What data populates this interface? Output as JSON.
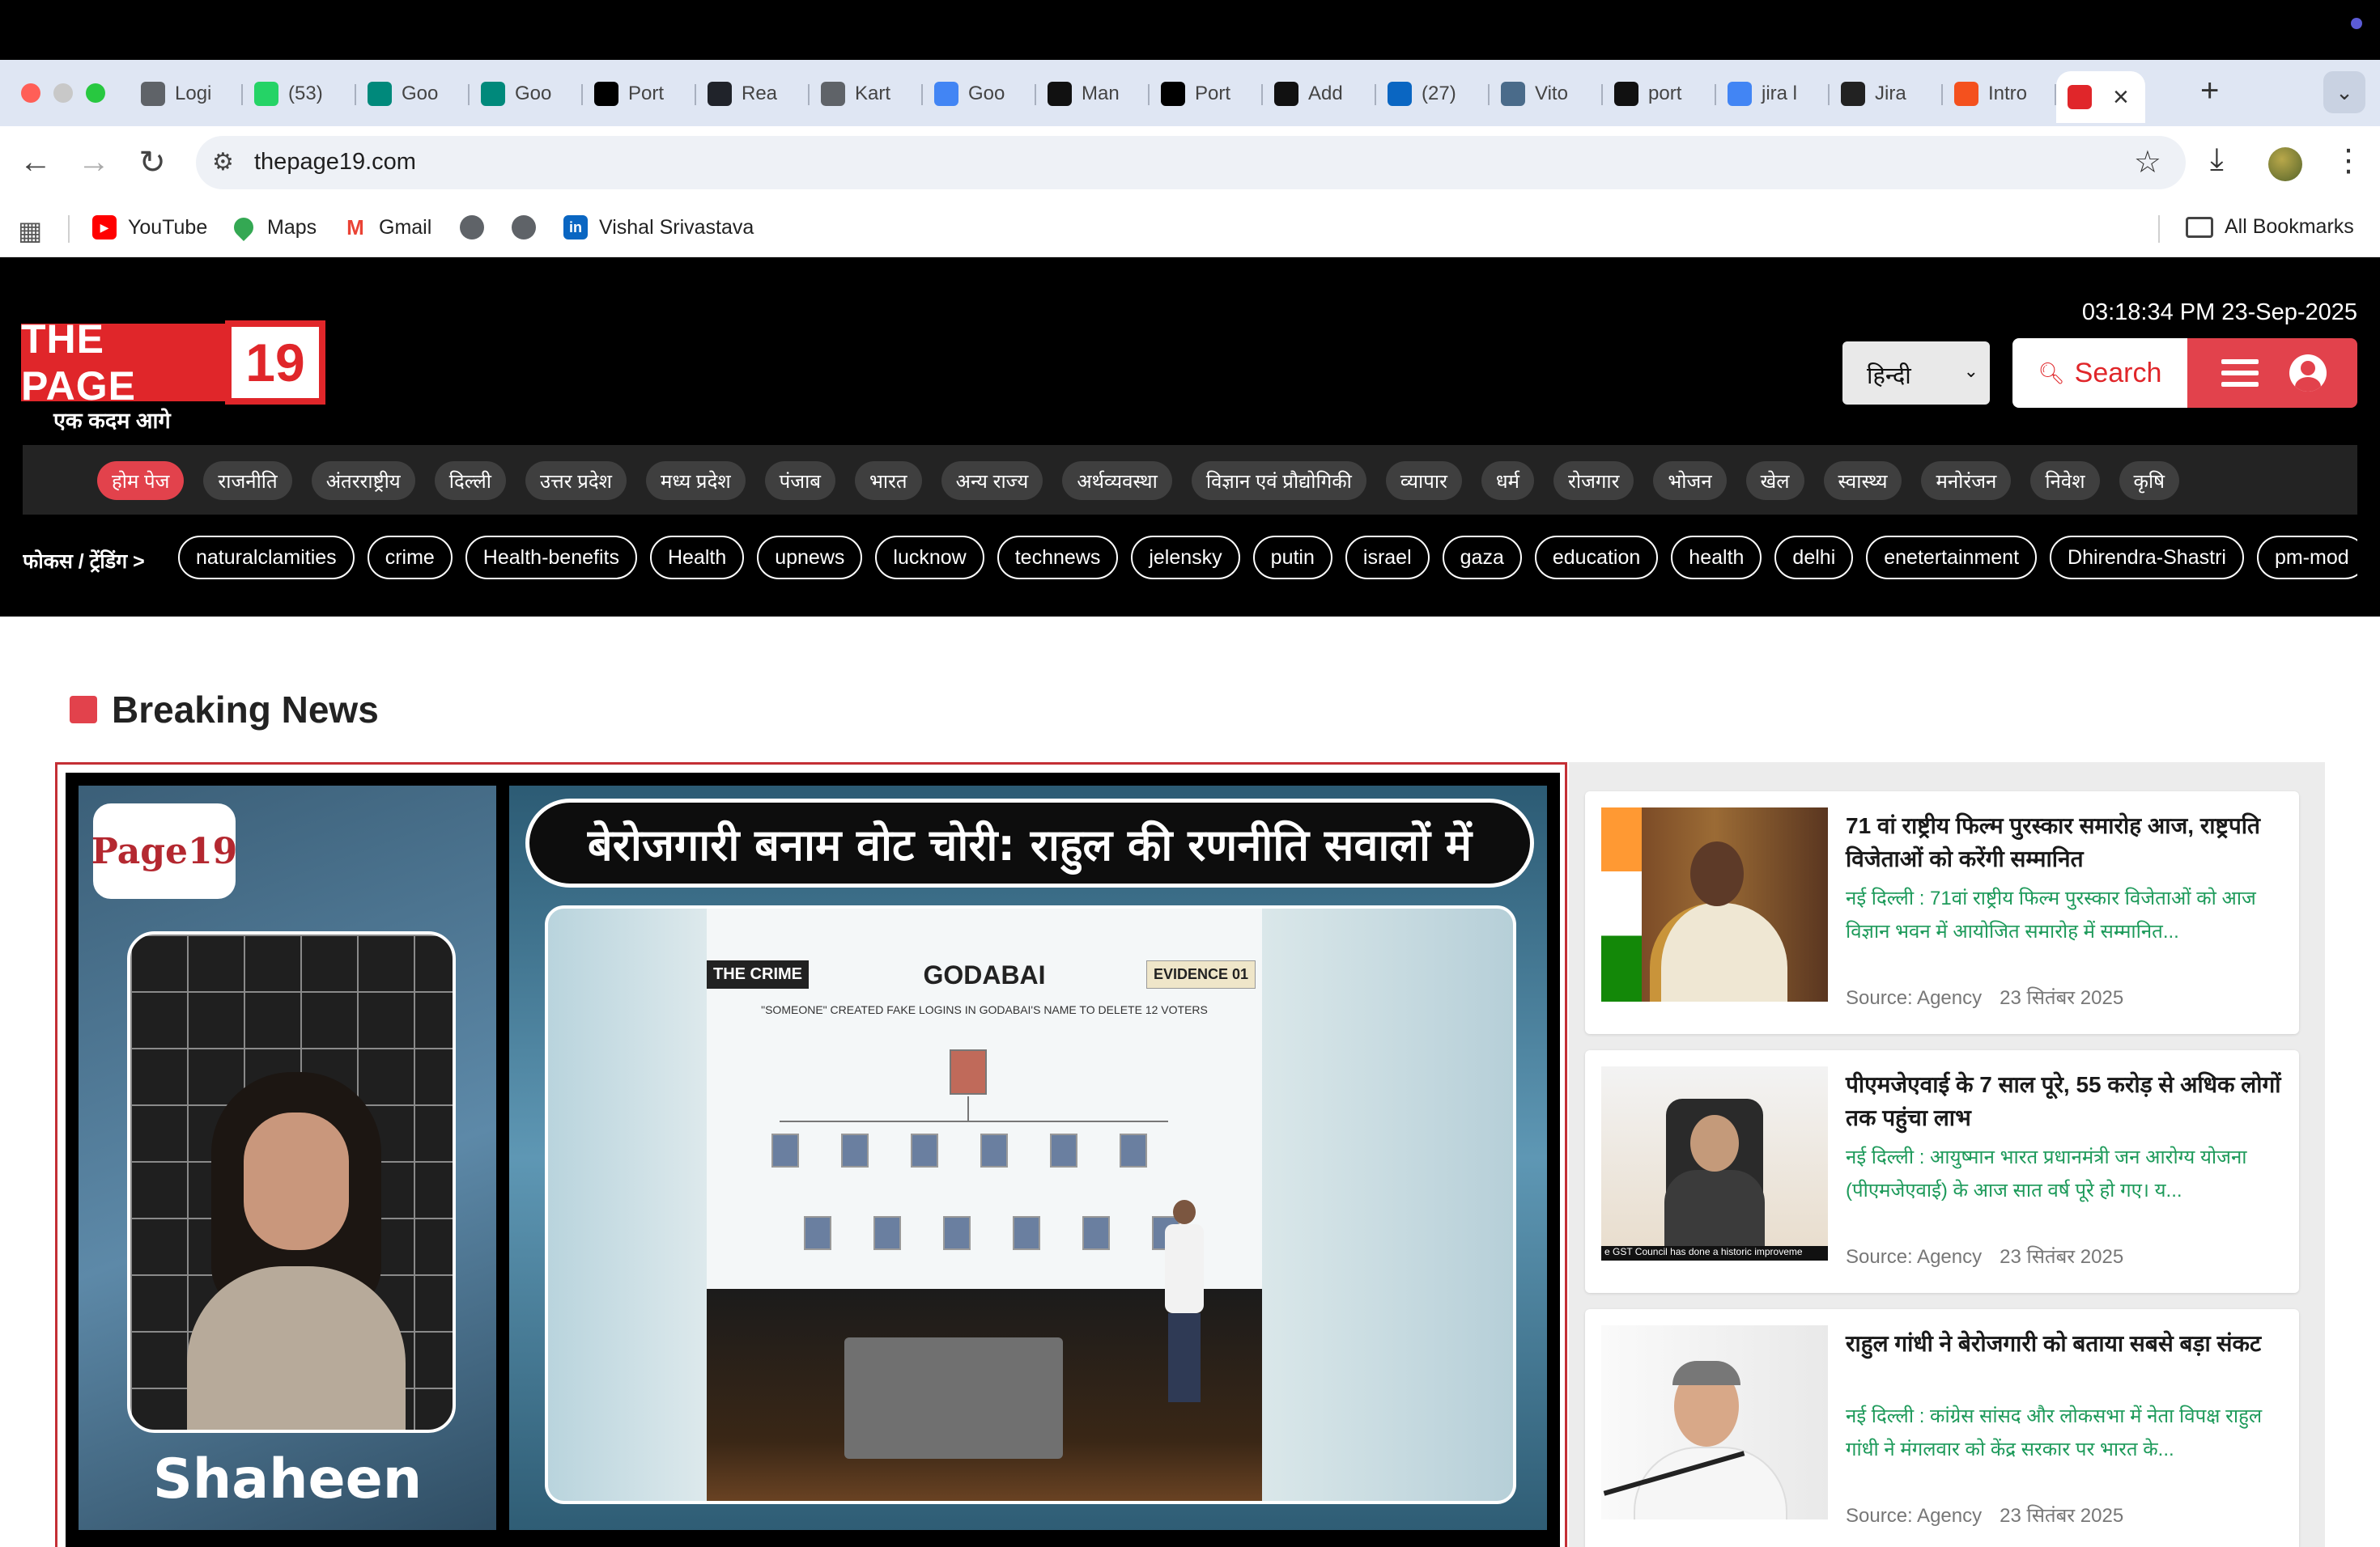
{
  "browser": {
    "tabs": [
      {
        "label": "Logi",
        "icon": "globe-icon",
        "color": "#5f6368"
      },
      {
        "label": "(53)",
        "icon": "whatsapp-icon",
        "color": "#25d366"
      },
      {
        "label": "Goo",
        "icon": "google-meet-icon",
        "color": "#00897b"
      },
      {
        "label": "Goo",
        "icon": "google-meet-icon",
        "color": "#00897b"
      },
      {
        "label": "Port",
        "icon": "vercel-icon",
        "color": "#000000"
      },
      {
        "label": "Rea",
        "icon": "react-icon",
        "color": "#20232a"
      },
      {
        "label": "Kart",
        "icon": "globe-icon",
        "color": "#5f6368"
      },
      {
        "label": "Goo",
        "icon": "gemini-icon",
        "color": "#4285f4"
      },
      {
        "label": "Man",
        "icon": "openai-icon",
        "color": "#111111"
      },
      {
        "label": "Port",
        "icon": "vercel-icon",
        "color": "#000000"
      },
      {
        "label": "Add",
        "icon": "openai-icon",
        "color": "#111111"
      },
      {
        "label": "(27)",
        "icon": "linkedin-icon",
        "color": "#0a66c2"
      },
      {
        "label": "Vito",
        "icon": "vitoria-icon",
        "color": "#4a6b8a"
      },
      {
        "label": "port",
        "icon": "github-icon",
        "color": "#111111"
      },
      {
        "label": "jira l",
        "icon": "google-icon",
        "color": "#4285f4"
      },
      {
        "label": "Jira",
        "icon": "hd-icon",
        "color": "#222222"
      },
      {
        "label": "Intro",
        "icon": "atlassian-icon",
        "color": "#f4511e"
      }
    ],
    "active_tab_icon": "thepage19-icon",
    "url": "thepage19.com",
    "bookmarks": [
      {
        "label": "YouTube",
        "icon": "youtube-icon"
      },
      {
        "label": "Maps",
        "icon": "maps-icon"
      },
      {
        "label": "Gmail",
        "icon": "gmail-icon"
      },
      {
        "label": "",
        "icon": "globe-icon"
      },
      {
        "label": "",
        "icon": "globe-icon"
      },
      {
        "label": "Vishal Srivastava",
        "icon": "linkedin-icon"
      }
    ],
    "all_bookmarks": "All Bookmarks"
  },
  "site": {
    "logo_text": "THE PAGE",
    "logo_number": "19",
    "tagline": "एक कदम आगे",
    "datetime": "03:18:34 PM 23-Sep-2025",
    "language": "हिन्दी",
    "search_label": "Search",
    "accent": "#e2424c",
    "categories": [
      "होम पेज",
      "राजनीति",
      "अंतरराष्ट्रीय",
      "दिल्ली",
      "उत्तर प्रदेश",
      "मध्य प्रदेश",
      "पंजाब",
      "भारत",
      "अन्य राज्य",
      "अर्थव्यवस्था",
      "विज्ञान एवं प्रौद्योगिकी",
      "व्यापार",
      "धर्म",
      "रोजगार",
      "भोजन",
      "खेल",
      "स्वास्थ्य",
      "मनोरंजन",
      "निवेश",
      "कृषि"
    ],
    "trending_label": "फोकस / ट्रेंडिंग >",
    "trending": [
      "naturalclamities",
      "crime",
      "Health-benefits",
      "Health",
      "upnews",
      "lucknow",
      "technews",
      "jelensky",
      "putin",
      "israel",
      "gaza",
      "education",
      "health",
      "delhi",
      "enetertainment",
      "Dhirendra-Shastri",
      "pm-mod"
    ]
  },
  "breaking": {
    "section_title": "Breaking News",
    "hero": {
      "small_logo": "Page19",
      "anchor_name": "Shaheen",
      "headline": "बेरोजगारी बनाम वोट चोरी: राहुल की रणनीति सवालों में",
      "slide_tag_left": "THE CRIME",
      "slide_title": "GODABAI",
      "slide_tag_right": "EVIDENCE 01",
      "slide_sub": "\"SOMEONE\" CREATED FAKE LOGINS IN GODABAI'S NAME TO DELETE 12 VOTERS"
    },
    "news": [
      {
        "title": "71 वां राष्ट्रीय फिल्म पुरस्कार समारोह आज, राष्ट्रपति विजेताओं को करेंगी सम्मानित",
        "summary": "नई दिल्ली : 71वां राष्ट्रीय फिल्म पुरस्कार विजेताओं को आज विज्ञान भवन में आयोजित समारोह में सम्मानित...",
        "source": "Source: Agency",
        "date": "23 सितंबर 2025"
      },
      {
        "title": "पीएमजेएवाई के 7 साल पूरे, 55 करोड़ से अधिक लोगों तक पहुंचा लाभ",
        "summary": "नई दिल्ली : आयुष्मान भारत प्रधानमंत्री जन आरोग्य योजना (पीएमजेएवाई) के आज सात वर्ष पूरे हो गए। य...",
        "source": "Source: Agency",
        "date": "23 सितंबर 2025",
        "thumb_caption": "e GST Council has done a historic improveme"
      },
      {
        "title": "राहुल गांधी ने बेरोजगारी को बताया सबसे बड़ा संकट",
        "summary": "नई दिल्ली : कांग्रेस सांसद और लोकसभा में नेता विपक्ष राहुल गांधी ने मंगलवार को केंद्र सरकार पर भारत के...",
        "source": "Source: Agency",
        "date": "23 सितंबर 2025"
      }
    ]
  }
}
